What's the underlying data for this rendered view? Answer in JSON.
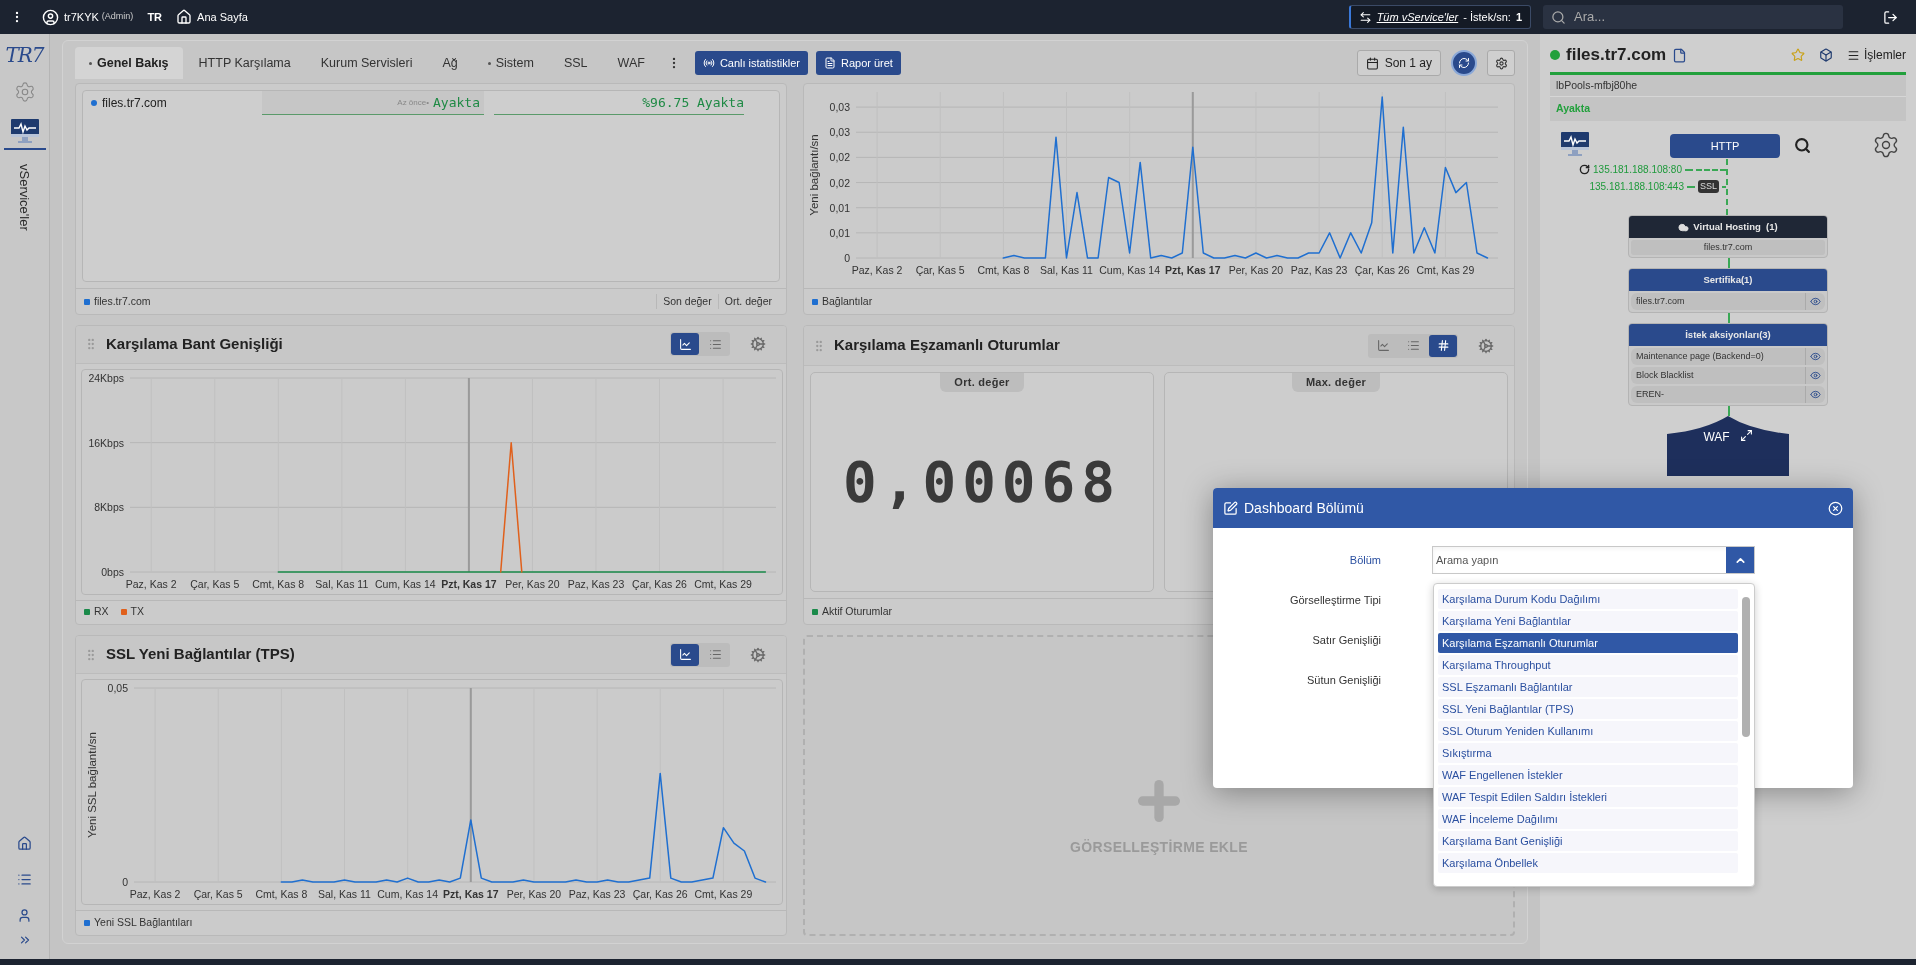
{
  "top_bar": {
    "user": "tr7KYK",
    "role": "(Admin)",
    "language": {
      "code": "TR",
      "selected": true
    },
    "home": "Ana Sayfa",
    "service_filter": {
      "link": "Tüm vService'ler",
      "label": "- İstek/sn:",
      "value": "1"
    },
    "search": {
      "placeholder": "Ara..."
    }
  },
  "sidebar": {
    "logo": "TR7",
    "nav": [
      {
        "selected": false
      },
      {
        "selected": true
      }
    ],
    "section_label": "vService'ler",
    "bottom_nav": [
      {
        "selected": false
      },
      {
        "selected": false
      },
      {
        "selected": false
      }
    ]
  },
  "tabs": [
    {
      "label": "Genel Bakış",
      "selected": true,
      "dot": true
    },
    {
      "label": "HTTP Karşılama",
      "selected": false,
      "dot": false
    },
    {
      "label": "Kurum Servisleri",
      "selected": false,
      "dot": false
    },
    {
      "label": "Ağ",
      "selected": false,
      "dot": false
    },
    {
      "label": "Sistem",
      "selected": false,
      "dot": true
    },
    {
      "label": "SSL",
      "selected": false,
      "dot": false
    },
    {
      "label": "WAF",
      "selected": false,
      "dot": false
    }
  ],
  "toolbar": {
    "buttons": [
      "Canlı istatistikler",
      "Rapor üret"
    ],
    "period": "Son 1 ay"
  },
  "widgets": [
    {
      "kind": "status",
      "rows": [
        {
          "name": "files.tr7.com",
          "color": "#1f6fd0",
          "time": "Az önce•",
          "status": "Ayakta",
          "uptime": "%96.75 Ayakta"
        }
      ],
      "legend": {
        "name": "files.tr7.com",
        "color": "#1f6fd0"
      },
      "columns": [
        "Son değer",
        "Ort. değer"
      ]
    },
    {
      "kind": "chart",
      "chart_data": {
        "type": "line",
        "ylabel": "Yeni bağlantı/sn",
        "grid": true,
        "categories": [
          null,
          null,
          "Paz, Kas 2",
          null,
          null,
          null,
          null,
          null,
          "Çar, Kas 5",
          null,
          null,
          null,
          null,
          null,
          "Cmt, Kas 8",
          null,
          null,
          null,
          null,
          null,
          "Sal, Kas 11",
          null,
          null,
          null,
          null,
          null,
          "Cum, Kas 14",
          null,
          null,
          null,
          null,
          null,
          "Pzt, Kas 17",
          null,
          null,
          null,
          null,
          null,
          "Per, Kas 20",
          null,
          null,
          null,
          null,
          null,
          "Paz, Kas 23",
          null,
          null,
          null,
          null,
          null,
          "Çar, Kas 26",
          null,
          null,
          null,
          null,
          null,
          "Cmt, Kas 29",
          null,
          null,
          null,
          null
        ],
        "ylim": [
          0,
          0.033
        ],
        "yticks": [
          {
            "value": 0,
            "label": "0"
          },
          {
            "value": 0.005,
            "label": "0,01"
          },
          {
            "value": 0.01,
            "label": "0,01"
          },
          {
            "value": 0.015,
            "label": "0,02"
          },
          {
            "value": 0.02,
            "label": "0,02"
          },
          {
            "value": 0.025,
            "label": "0,03"
          },
          {
            "value": 0.03,
            "label": "0,03"
          }
        ],
        "ref_lines": [
          {
            "axis": "x",
            "value": "Pzt, Kas 17"
          }
        ],
        "series": [
          {
            "name": "Bağlantılar",
            "color": "#1f6fd0",
            "values": [
              null,
              null,
              null,
              null,
              null,
              null,
              null,
              null,
              null,
              null,
              null,
              null,
              null,
              null,
              0,
              0.0005,
              0,
              0,
              0,
              0.024,
              0,
              0.013,
              0,
              0,
              0.016,
              0.015,
              0.001,
              0.019,
              0,
              0.0005,
              0,
              0.001,
              0.022,
              0.001,
              0,
              0,
              0.0005,
              0,
              0.001,
              0,
              0.0005,
              0,
              0,
              0.001,
              0.001,
              0.005,
              0,
              0.005,
              0.001,
              0.007,
              0.032,
              0.001,
              0.026,
              0.001,
              0.006,
              0.001,
              0.018,
              0.013,
              0.015,
              0.001,
              0
            ]
          }
        ]
      }
    },
    {
      "kind": "chart",
      "title": "Karşılama Bant Genişliği",
      "views": [
        {
          "selected": true
        },
        {
          "selected": false
        }
      ],
      "chart_data": {
        "type": "line",
        "grid": true,
        "categories": [
          null,
          null,
          "Paz, Kas 2",
          null,
          null,
          null,
          null,
          null,
          "Çar, Kas 5",
          null,
          null,
          null,
          null,
          null,
          "Cmt, Kas 8",
          null,
          null,
          null,
          null,
          null,
          "Sal, Kas 11",
          null,
          null,
          null,
          null,
          null,
          "Cum, Kas 14",
          null,
          null,
          null,
          null,
          null,
          "Pzt, Kas 17",
          null,
          null,
          null,
          null,
          null,
          "Per, Kas 20",
          null,
          null,
          null,
          null,
          null,
          "Paz, Kas 23",
          null,
          null,
          null,
          null,
          null,
          "Çar, Kas 26",
          null,
          null,
          null,
          null,
          null,
          "Cmt, Kas 29",
          null,
          null,
          null,
          null
        ],
        "ylim": [
          0,
          24
        ],
        "yticks": [
          {
            "value": 0,
            "label": "0bps"
          },
          {
            "value": 8,
            "label": "8Kbps"
          },
          {
            "value": 16,
            "label": "16Kbps"
          },
          {
            "value": 24,
            "label": "24Kbps"
          }
        ],
        "ref_lines": [
          {
            "axis": "x",
            "value": "Pzt, Kas 17"
          }
        ],
        "series": [
          {
            "name": "RX",
            "color": "#1a8a4a",
            "values": [
              null,
              null,
              null,
              null,
              null,
              null,
              null,
              null,
              null,
              null,
              null,
              null,
              null,
              null,
              0,
              0,
              0,
              0,
              0,
              0,
              0,
              0,
              0,
              0,
              0,
              0,
              0,
              0,
              0,
              0,
              0,
              0,
              0,
              0,
              0,
              0,
              0,
              0,
              0,
              0,
              0,
              0,
              0,
              0,
              0,
              0,
              0,
              0,
              0,
              0,
              0,
              0,
              0,
              0,
              0,
              0,
              0,
              0,
              0,
              0,
              0
            ]
          },
          {
            "name": "TX",
            "color": "#e0601c",
            "values": [
              null,
              null,
              null,
              null,
              null,
              null,
              null,
              null,
              null,
              null,
              null,
              null,
              null,
              null,
              null,
              null,
              null,
              null,
              null,
              null,
              null,
              null,
              null,
              null,
              null,
              null,
              null,
              null,
              null,
              null,
              null,
              null,
              null,
              null,
              null,
              0,
              16,
              0,
              null,
              null,
              null,
              null,
              null,
              null,
              null,
              null,
              null,
              null,
              null,
              null,
              null,
              null,
              null,
              null,
              null,
              null,
              null,
              null,
              null,
              null,
              null
            ]
          }
        ]
      }
    },
    {
      "kind": "stat",
      "title": "Karşılama Eşzamanlı Oturumlar",
      "views": [
        {
          "selected": false
        },
        {
          "selected": false
        },
        {
          "selected": true
        }
      ],
      "stats": [
        {
          "label": "Ort. değer",
          "value": "0,00068"
        },
        {
          "label": "Max. değer"
        }
      ],
      "legend": {
        "name": "Aktif Oturumlar",
        "color": "#1a8a4a"
      }
    },
    {
      "kind": "chart",
      "title": "SSL Yeni Bağlantılar (TPS)",
      "views": [
        {
          "selected": true
        },
        {
          "selected": false
        }
      ],
      "chart_data": {
        "type": "line",
        "ylabel": "Yeni SSL bağlantı/sn",
        "grid": true,
        "categories": [
          null,
          null,
          "Paz, Kas 2",
          null,
          null,
          null,
          null,
          null,
          "Çar, Kas 5",
          null,
          null,
          null,
          null,
          null,
          "Cmt, Kas 8",
          null,
          null,
          null,
          null,
          null,
          "Sal, Kas 11",
          null,
          null,
          null,
          null,
          null,
          "Cum, Kas 14",
          null,
          null,
          null,
          null,
          null,
          "Pzt, Kas 17",
          null,
          null,
          null,
          null,
          null,
          "Per, Kas 20",
          null,
          null,
          null,
          null,
          null,
          "Paz, Kas 23",
          null,
          null,
          null,
          null,
          null,
          "Çar, Kas 26",
          null,
          null,
          null,
          null,
          null,
          "Cmt, Kas 29",
          null,
          null,
          null,
          null
        ],
        "ylim": [
          0,
          0.05
        ],
        "yticks": [
          {
            "value": 0,
            "label": "0"
          },
          {
            "value": 0.05,
            "label": "0,05"
          }
        ],
        "ref_lines": [
          {
            "axis": "x",
            "value": "Pzt, Kas 17"
          }
        ],
        "series": [
          {
            "name": "Yeni SSL Bağlantıları",
            "color": "#1f6fd0",
            "values": [
              null,
              null,
              null,
              null,
              null,
              null,
              null,
              null,
              null,
              null,
              null,
              null,
              null,
              null,
              0,
              0,
              0.0005,
              0,
              0,
              0,
              0.0005,
              0,
              0,
              0,
              0.0005,
              0,
              0.001,
              0,
              0,
              0.0005,
              0,
              0.001,
              0.016,
              0.001,
              0,
              0,
              0,
              0.0005,
              0,
              0,
              0,
              0,
              0.0005,
              0,
              0,
              0.0005,
              0,
              0,
              0.0005,
              0.001,
              0.028,
              0.001,
              0,
              0,
              0.0005,
              0.001,
              0.014,
              0.01,
              0.008,
              0.001,
              0
            ]
          }
        ]
      }
    },
    {
      "kind": "add",
      "label": "GÖRSELLEŞTİRME EKLE"
    }
  ],
  "right_panel": {
    "title": "files.tr7.com",
    "color": "#22a03c",
    "actions": "İşlemler",
    "pool": "lbPools-mfbj80he",
    "status": "Ayakta",
    "protocol": "HTTP",
    "listeners": [
      {
        "kind": "plain",
        "address": "135.181.188.108:80"
      },
      {
        "kind": "ssl",
        "address": "135.181.188.108:443",
        "badge": "SSL"
      }
    ],
    "groups": [
      {
        "kind": "hosting",
        "title": "Virtual Hosting  (1)",
        "items": [
          {
            "label": "files.tr7.com"
          }
        ]
      },
      {
        "kind": "certificate",
        "title": "Sertifika(1)",
        "items": [
          {
            "label": "files.tr7.com"
          }
        ]
      },
      {
        "kind": "actions",
        "title": "İstek aksiyonları(3)",
        "items": [
          {
            "label": "Maintenance page (Backend=0)"
          },
          {
            "label": "Block Blacklist"
          },
          {
            "label": "EREN-"
          }
        ]
      }
    ],
    "waf": {
      "label": "WAF"
    }
  },
  "dialog": {
    "title": "Dashboard Bölümü",
    "fields": [
      {
        "label": "Bölüm",
        "placeholder": "Arama yapın",
        "focused": true
      },
      {
        "label": "Görselleştirme Tipi",
        "focused": false
      },
      {
        "label": "Satır Genişliği",
        "focused": false
      },
      {
        "label": "Sütun Genişliği",
        "focused": false
      }
    ],
    "options": [
      {
        "label": "Karşılama Durum Kodu Dağılımı",
        "selected": false
      },
      {
        "label": "Karşılama Yeni Bağlantılar",
        "selected": false
      },
      {
        "label": "Karşılama Eşzamanlı Oturumlar",
        "selected": true
      },
      {
        "label": "Karşılama Throughput",
        "selected": false
      },
      {
        "label": "SSL Eşzamanlı Bağlantılar",
        "selected": false
      },
      {
        "label": "SSL Yeni Bağlantılar (TPS)",
        "selected": false
      },
      {
        "label": "SSL Oturum Yeniden Kullanımı",
        "selected": false
      },
      {
        "label": "Sıkıştırma",
        "selected": false
      },
      {
        "label": "WAF Engellenen İstekler",
        "selected": false
      },
      {
        "label": "WAF Tespit Edilen Saldırı İstekleri",
        "selected": false
      },
      {
        "label": "WAF İnceleme Dağılımı",
        "selected": false
      },
      {
        "label": "Karşılama Bant Genişliği",
        "selected": false
      },
      {
        "label": "Karşılama Önbellek",
        "selected": false
      }
    ]
  }
}
